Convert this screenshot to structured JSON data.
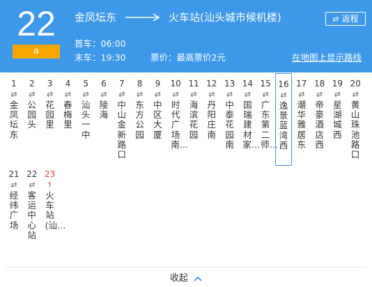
{
  "route": {
    "number": "22",
    "badge": "a"
  },
  "direction": {
    "from": "金凤坛东",
    "to": "火车站(汕头城市候机楼)"
  },
  "return_button": {
    "icon": "swap-icon",
    "label": "返程"
  },
  "schedule": {
    "first": "首车：06:00",
    "last": "末车：19:30"
  },
  "fare": "票价：最高票价2元",
  "map_link": "在地图上显示路线",
  "stops": [
    {
      "num": "1",
      "name": "金凤坛东"
    },
    {
      "num": "2",
      "name": "公园头"
    },
    {
      "num": "3",
      "name": "花园里"
    },
    {
      "num": "4",
      "name": "春梅里"
    },
    {
      "num": "5",
      "name": "汕头一中"
    },
    {
      "num": "6",
      "name": "陵海"
    },
    {
      "num": "7",
      "name": "中山金新路口"
    },
    {
      "num": "8",
      "name": "东方公园"
    },
    {
      "num": "9",
      "name": "中区大厦"
    },
    {
      "num": "10",
      "name": "时代广场南…"
    },
    {
      "num": "11",
      "name": "海滨花园"
    },
    {
      "num": "12",
      "name": "丹阳庄南"
    },
    {
      "num": "13",
      "name": "中泰花园南"
    },
    {
      "num": "14",
      "name": "国瑞建材家…"
    },
    {
      "num": "15",
      "name": "广东第二师…"
    },
    {
      "num": "16",
      "name": "逸景蓝湾西"
    },
    {
      "num": "17",
      "name": "潮华雅居东"
    },
    {
      "num": "18",
      "name": "帝豪酒店西"
    },
    {
      "num": "19",
      "name": "星湖城西"
    },
    {
      "num": "20",
      "name": "黄山珠池路口"
    },
    {
      "num": "21",
      "name": "经纬广场"
    },
    {
      "num": "22",
      "name": "客运中心站"
    },
    {
      "num": "23",
      "name": "火车站(汕…"
    }
  ],
  "stop_icon": "⇄",
  "end_icon": "↿",
  "collapse": {
    "label": "收起",
    "icon": "chevron-up-icon"
  },
  "colors": {
    "header": "#3d98ea",
    "badge": "#f7a700",
    "terminal": "#e0413b"
  }
}
